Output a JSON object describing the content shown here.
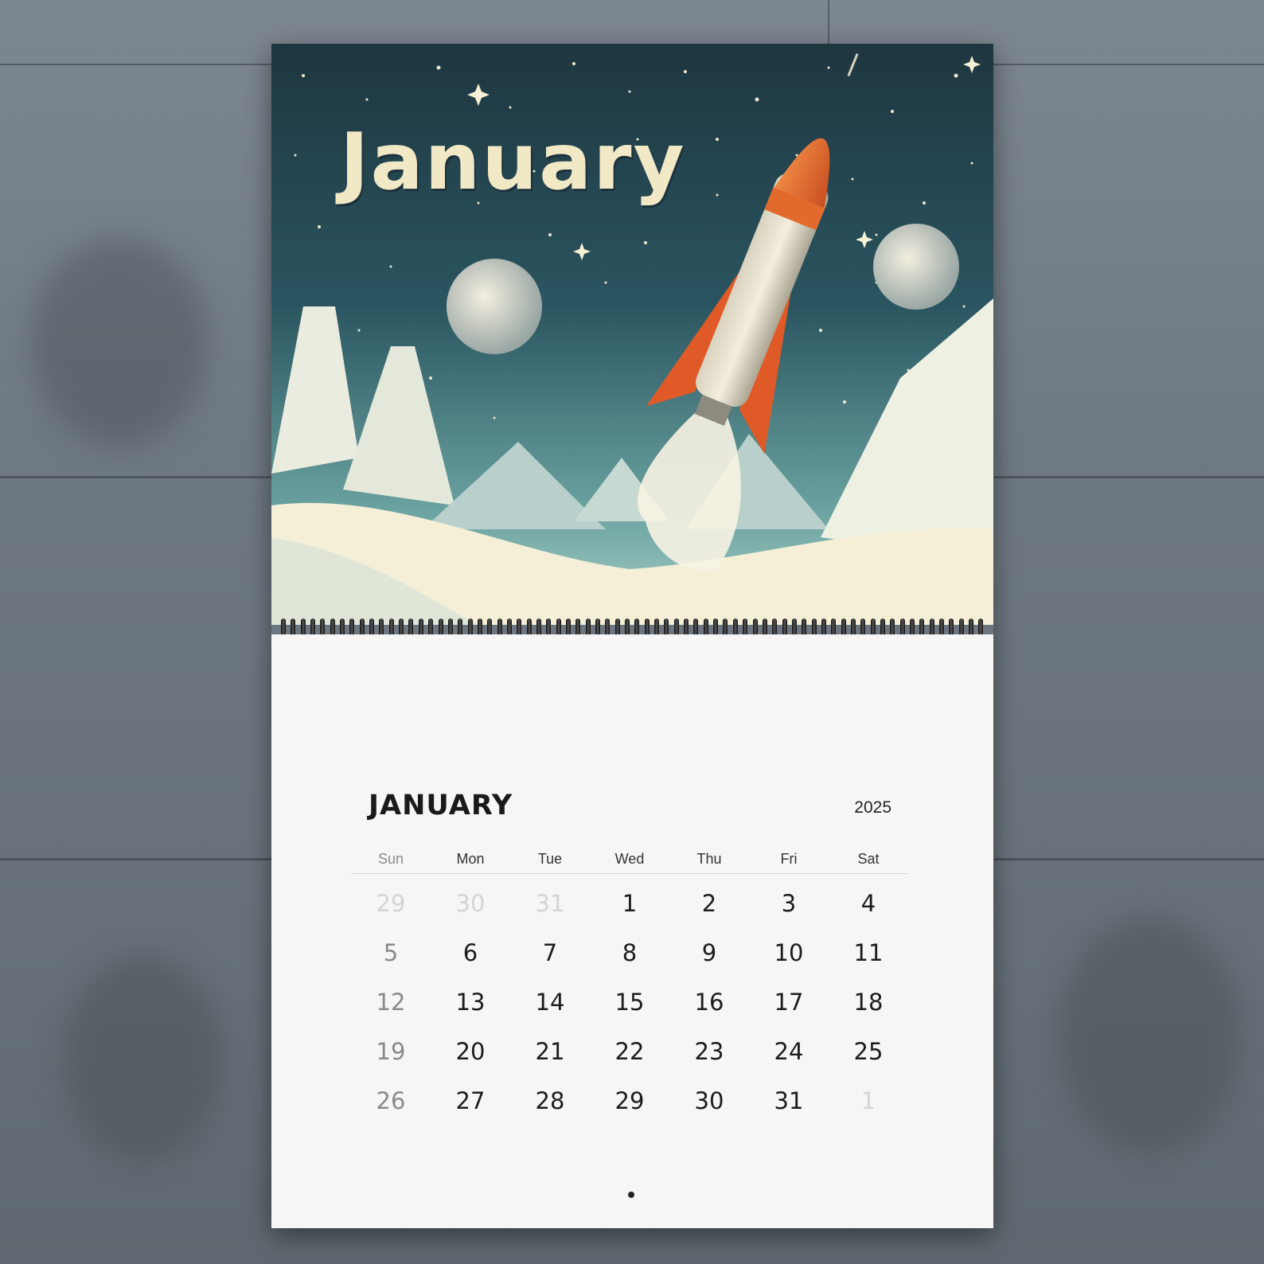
{
  "artwork": {
    "month_title": "January",
    "colors": {
      "sky": "#1f3a45",
      "rocket": "#e26a2c",
      "snow": "#f4efd6"
    }
  },
  "grid": {
    "month": "JANUARY",
    "year": "2025",
    "weekdays": [
      "Sun",
      "Mon",
      "Tue",
      "Wed",
      "Thu",
      "Fri",
      "Sat"
    ],
    "weeks": [
      [
        "29",
        "30",
        "31",
        "1",
        "2",
        "3",
        "4"
      ],
      [
        "5",
        "6",
        "7",
        "8",
        "9",
        "10",
        "11"
      ],
      [
        "12",
        "13",
        "14",
        "15",
        "16",
        "17",
        "18"
      ],
      [
        "19",
        "20",
        "21",
        "22",
        "23",
        "24",
        "25"
      ],
      [
        "26",
        "27",
        "28",
        "29",
        "30",
        "31",
        "1"
      ]
    ]
  }
}
